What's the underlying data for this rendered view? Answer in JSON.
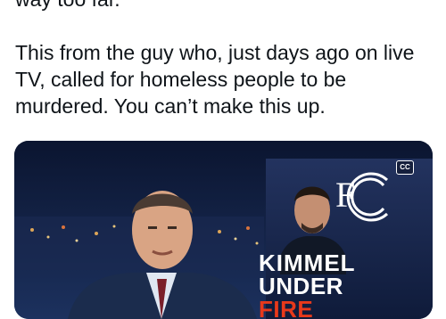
{
  "post": {
    "cut_line": "way too far.",
    "paragraph": "This from the guy who, just days ago on live TV, called for homeless people to be murdered. You can’t make this up."
  },
  "media": {
    "cc_label": "CC",
    "fcc_logo_text": "FCC",
    "headline_line1": "KIMMEL",
    "headline_line2_a": "UNDER",
    "headline_line2_b": "FIRE"
  }
}
